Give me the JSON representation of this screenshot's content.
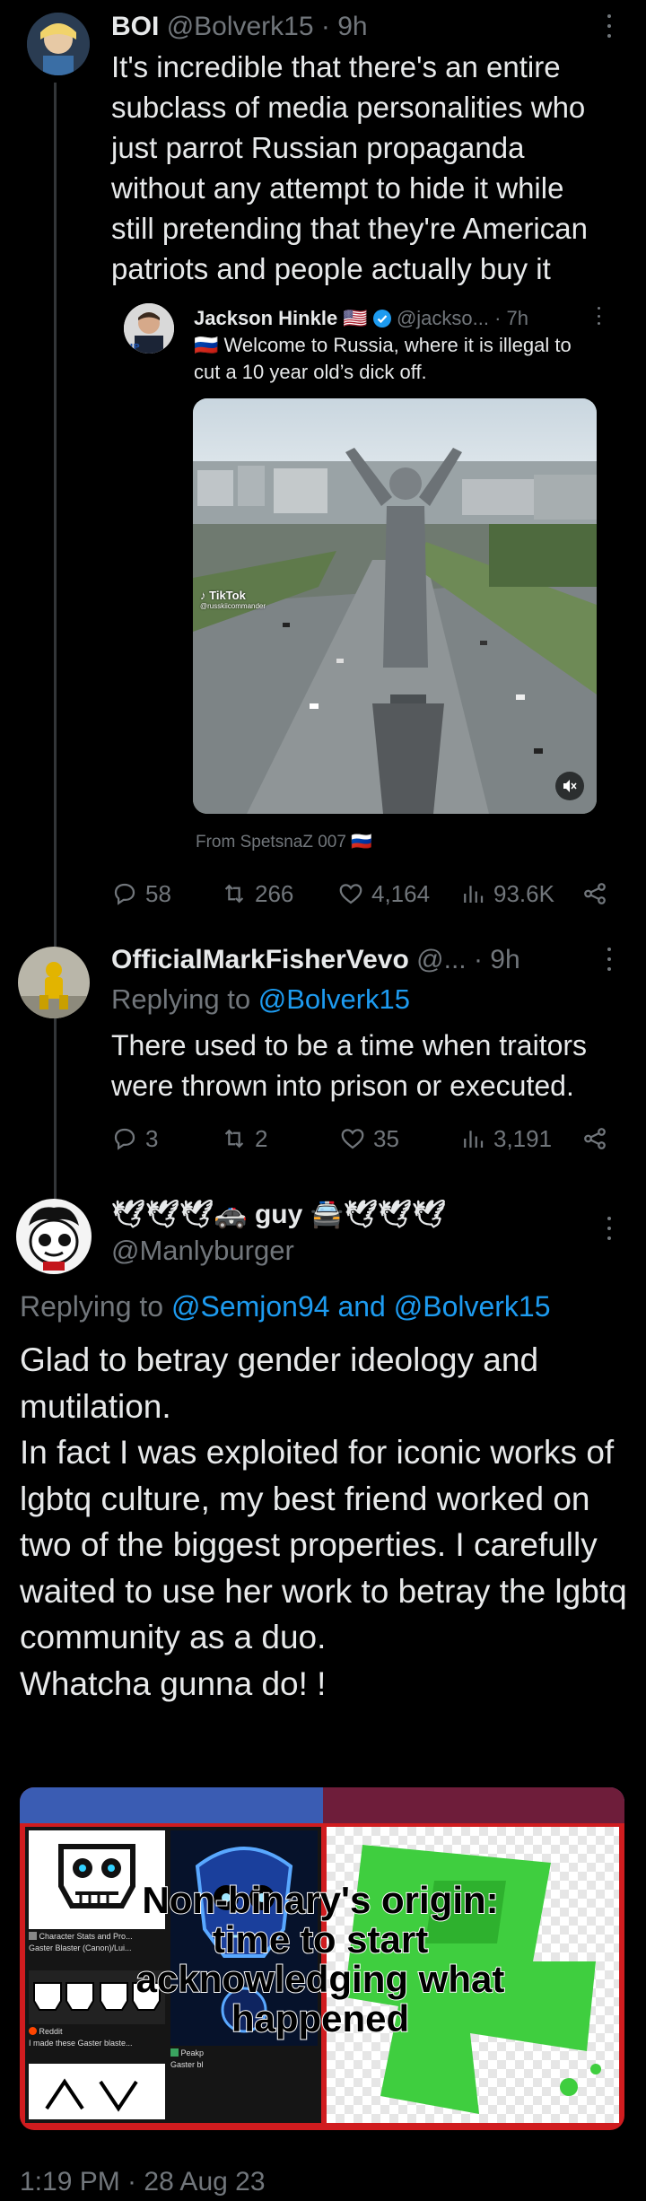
{
  "tweet1": {
    "name": "BOI",
    "handle": "@Bolverk15",
    "time": "· 9h",
    "text": "It's incredible that there's an entire subclass of media personalities who just parrot Russian propaganda without any attempt to hide it while still pretending that they're American patriots and people actually buy it",
    "quote": {
      "name": "Jackson Hinkle 🇺🇸",
      "handle": "@jackso...",
      "time": "· 7h",
      "text": "🇷🇺 Welcome to Russia, where it is illegal to cut a 10 year old’s dick off.",
      "video_watermark": "TikTok",
      "video_watermark_user": "@russkiicommander",
      "from": "From SpetsnaZ 007 🇷🇺"
    },
    "replies": "58",
    "reposts": "266",
    "likes": "4,164",
    "views": "93.6K"
  },
  "tweet2": {
    "name": "OfficialMarkFisherVevo",
    "handle": "@...",
    "time": "· 9h",
    "replying_prefix": "Replying to",
    "replying_to": "@Bolverk15",
    "text": "There used to be a time when traitors were thrown into prison or executed.",
    "replies": "3",
    "reposts": "2",
    "likes": "35",
    "views": "3,191"
  },
  "tweet3": {
    "name": "🕊🕊🕊🚓 guy 🚔🕊🕊🕊",
    "handle": "@Manlyburger",
    "replying_prefix": "Replying to",
    "replying_to": "@Semjon94 and @Bolverk15",
    "text": "Glad to betray gender ideology and mutilation.\nIn fact I was exploited for iconic works of lgbtq culture, my best friend worked on two of the biggest properties. I carefully waited to use her work to betray the lgbtq community as a duo.\nWhatcha gunna do! !",
    "meme": {
      "caption": "Non-binary's origin: time to start acknowledging what happened",
      "card1_title": "Character Stats and Pro...",
      "card1_sub": "Gaster Blaster (Canon)/Lui...",
      "card2_source": "Reddit",
      "card2_sub": "I made these Gaster blaste...",
      "card3_source": "Peakp",
      "card3_sub": "Gaster bl"
    },
    "timestamp": "1:19 PM · 28 Aug 23"
  },
  "colors": {
    "background": "#000000",
    "text": "#e7e9ea",
    "secondary": "#71767b",
    "link": "#1d9bf0",
    "meme_frame": "#d01c1f"
  }
}
